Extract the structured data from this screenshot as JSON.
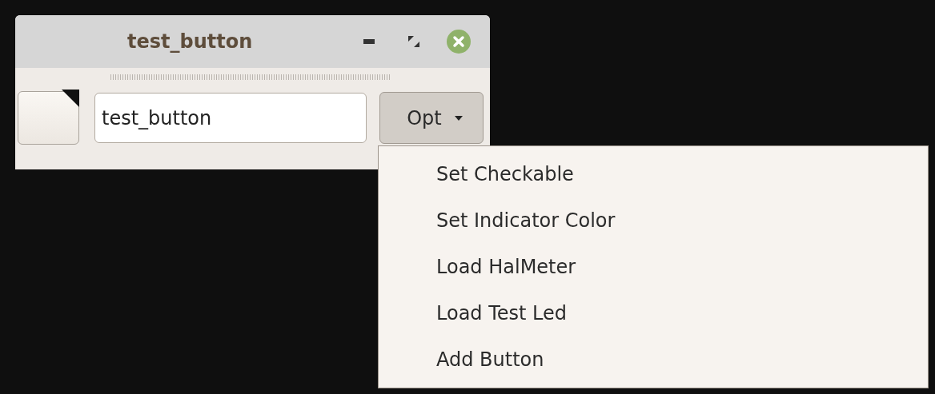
{
  "window": {
    "title": "test_button"
  },
  "name_field": {
    "value": "test_button"
  },
  "options_button": {
    "label": "Opt"
  },
  "menu": {
    "items": [
      {
        "label": "Set Checkable"
      },
      {
        "label": "Set Indicator Color"
      },
      {
        "label": "Load HalMeter"
      },
      {
        "label": "Load Test Led"
      },
      {
        "label": "Add Button"
      }
    ]
  }
}
